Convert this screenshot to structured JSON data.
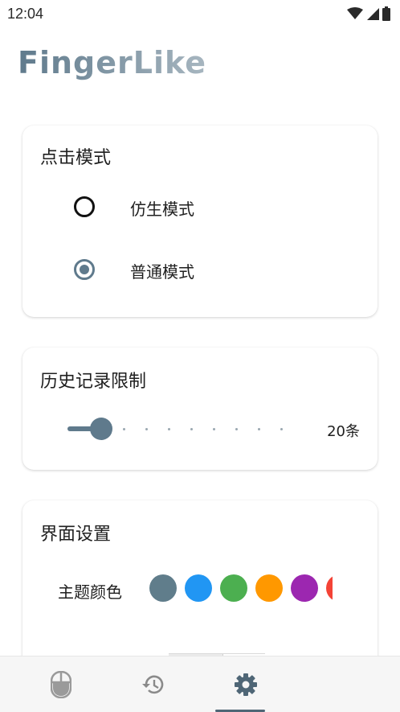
{
  "status_bar": {
    "time": "12:04",
    "icons": [
      "wifi-icon",
      "signal-icon",
      "battery-icon"
    ]
  },
  "app": {
    "title": "FingerLike",
    "accent_color": "#5f7a8c"
  },
  "click_mode": {
    "title": "点击模式",
    "options": [
      {
        "label": "仿生模式",
        "selected": false
      },
      {
        "label": "普通模式",
        "selected": true
      }
    ]
  },
  "history_limit": {
    "title": "历史记录限制",
    "value_label": "20条",
    "slider": {
      "min_step": 0,
      "max_step": 9,
      "current_step": 1
    }
  },
  "ui_settings": {
    "title": "界面设置",
    "theme_color_label": "主题颜色",
    "theme_colors": [
      "#607d8b",
      "#2196f3",
      "#4caf50",
      "#ff9800",
      "#9c27b0",
      "#f44336"
    ]
  },
  "bottom_nav": {
    "items": [
      {
        "icon": "mouse-icon",
        "active": false
      },
      {
        "icon": "history-icon",
        "active": false
      },
      {
        "icon": "gear-icon",
        "active": true
      }
    ]
  }
}
